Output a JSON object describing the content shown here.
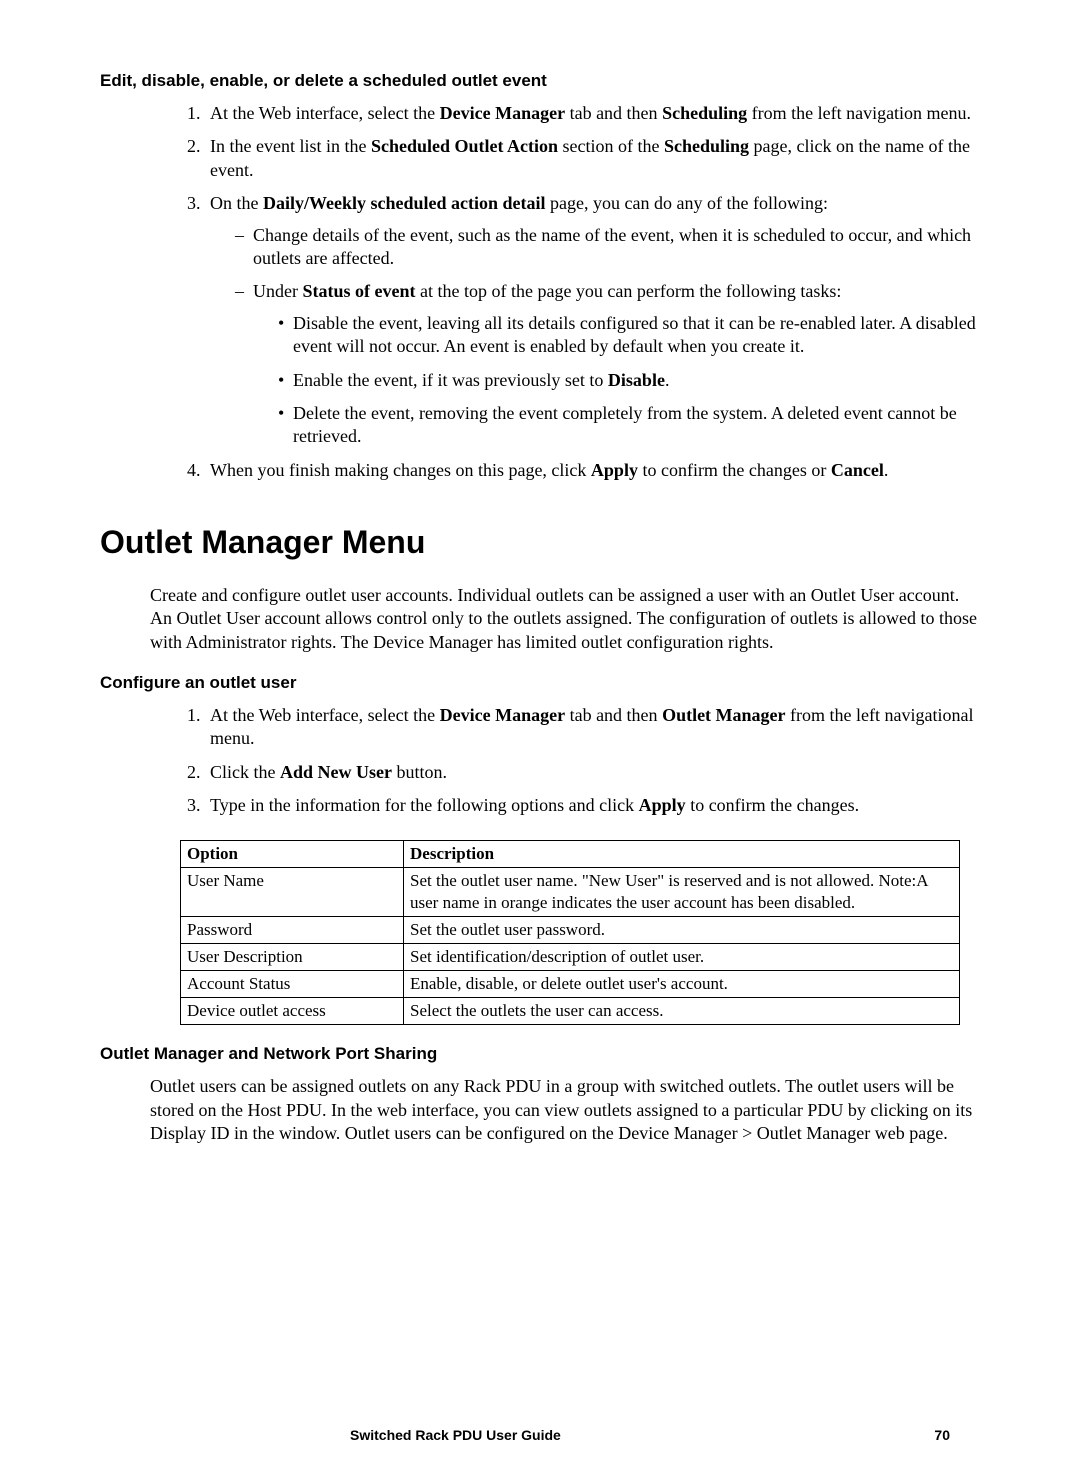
{
  "section1": {
    "heading": "Edit, disable, enable, or delete a scheduled outlet event",
    "items": [
      {
        "pre": "At the Web interface, select the ",
        "b1": "Device Manager",
        "mid": " tab and then ",
        "b2": "Scheduling",
        "post": " from the left navigation menu."
      },
      {
        "pre": "In the event list in the ",
        "b1": "Scheduled Outlet Action",
        "mid": " section of the ",
        "b2": "Scheduling",
        "post": " page, click on the name of the event."
      },
      {
        "pre": "On the ",
        "b1": "Daily/Weekly scheduled action detail",
        "post": " page, you can do any of the following:",
        "sub": [
          {
            "text": "Change details of the event, such as the name of the event, when it is scheduled to occur, and which outlets are affected."
          },
          {
            "pre": "Under ",
            "b1": "Status of event",
            "post": " at the top of the page you can perform the following tasks:",
            "bullets": [
              "Disable the event, leaving all its details configured so that it can be re-enabled later. A disabled event will not occur. An event is enabled by default when you create it.",
              {
                "pre": "Enable the event, if it was previously set to ",
                "b1": "Disable",
                "post": "."
              },
              "Delete the event, removing the event completely from the system. A deleted event cannot be retrieved."
            ]
          }
        ]
      },
      {
        "pre": "When you finish making changes on this page, click ",
        "b1": "Apply",
        "mid": " to confirm the changes or ",
        "b2": "Cancel",
        "post": "."
      }
    ]
  },
  "h1": "Outlet Manager Menu",
  "intro": "Create and configure outlet user accounts. Individual outlets can be assigned a user with an Outlet User account. An Outlet User account allows control only to the outlets assigned. The configuration of outlets is allowed to those with Administrator rights. The Device Manager has limited outlet configuration rights.",
  "section2": {
    "heading": "Configure an outlet user",
    "items": [
      {
        "pre": "At the Web interface, select the ",
        "b1": "Device Manager",
        "mid": " tab and then ",
        "b2": "Outlet Manager",
        "post": " from the left navigational menu."
      },
      {
        "pre": "Click the ",
        "b1": "Add New User",
        "post": " button."
      },
      {
        "pre": "Type in the information for the following options and click ",
        "b1": "Apply",
        "post": " to confirm the changes."
      }
    ]
  },
  "table": {
    "head": {
      "c1": "Option",
      "c2": "Description"
    },
    "rows": [
      {
        "c1": "User Name",
        "c2": "Set the outlet user name. \"New User\" is reserved and is not allowed. Note:A user name in orange indicates the user account has been disabled."
      },
      {
        "c1": "Password",
        "c2": "Set the outlet user password."
      },
      {
        "c1": "User Description",
        "c2": "Set identification/description of outlet user."
      },
      {
        "c1": "Account Status",
        "c2": "Enable, disable, or delete outlet user's account."
      },
      {
        "c1": "Device outlet access",
        "c2": "Select the outlets the user can access."
      }
    ]
  },
  "section3": {
    "heading": "Outlet Manager and Network Port Sharing",
    "para": "Outlet users can be assigned outlets on any Rack PDU in a group with switched outlets.  The outlet users will be stored on the Host PDU. In the web interface, you can view outlets assigned to a particular PDU by clicking on its Display ID in the window.  Outlet users can be configured on the Device Manager > Outlet Manager web page."
  },
  "footer": {
    "title": "Switched Rack PDU User Guide",
    "page": "70"
  }
}
